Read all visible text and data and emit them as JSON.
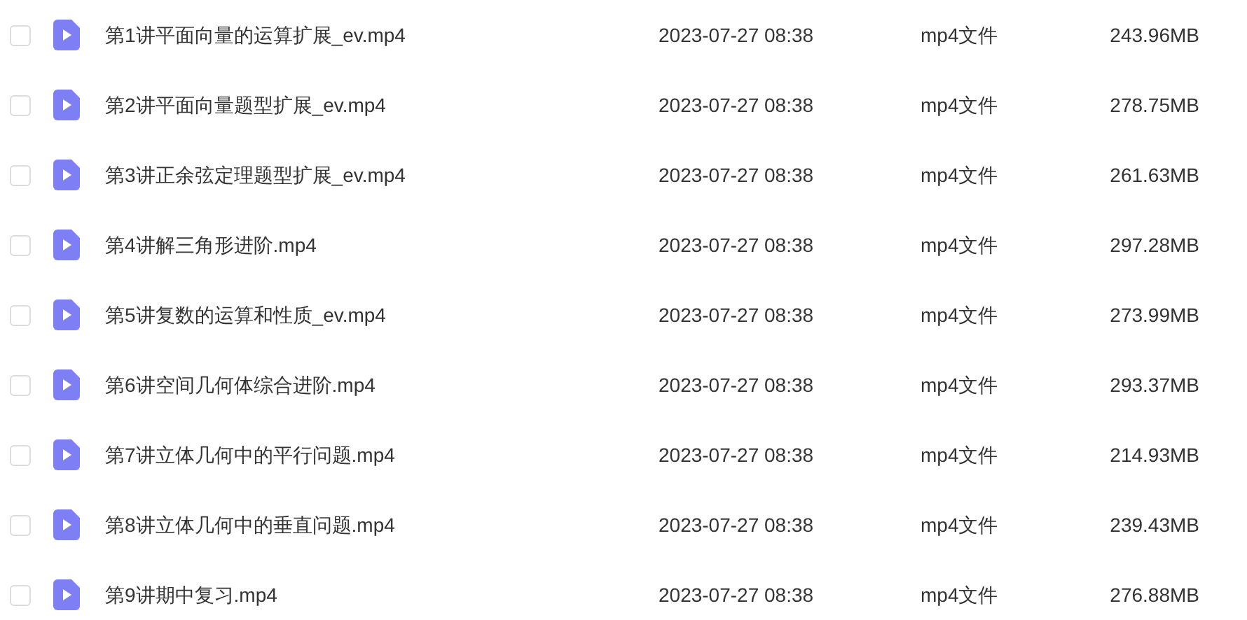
{
  "files": [
    {
      "name": "第1讲平面向量的运算扩展_ev.mp4",
      "date": "2023-07-27 08:38",
      "type": "mp4文件",
      "size": "243.96MB",
      "checked": false
    },
    {
      "name": "第2讲平面向量题型扩展_ev.mp4",
      "date": "2023-07-27 08:38",
      "type": "mp4文件",
      "size": "278.75MB",
      "checked": false
    },
    {
      "name": "第3讲正余弦定理题型扩展_ev.mp4",
      "date": "2023-07-27 08:38",
      "type": "mp4文件",
      "size": "261.63MB",
      "checked": false
    },
    {
      "name": "第4讲解三角形进阶.mp4",
      "date": "2023-07-27 08:38",
      "type": "mp4文件",
      "size": "297.28MB",
      "checked": false
    },
    {
      "name": "第5讲复数的运算和性质_ev.mp4",
      "date": "2023-07-27 08:38",
      "type": "mp4文件",
      "size": "273.99MB",
      "checked": false
    },
    {
      "name": "第6讲空间几何体综合进阶.mp4",
      "date": "2023-07-27 08:38",
      "type": "mp4文件",
      "size": "293.37MB",
      "checked": false
    },
    {
      "name": "第7讲立体几何中的平行问题.mp4",
      "date": "2023-07-27 08:38",
      "type": "mp4文件",
      "size": "214.93MB",
      "checked": false
    },
    {
      "name": "第8讲立体几何中的垂直问题.mp4",
      "date": "2023-07-27 08:38",
      "type": "mp4文件",
      "size": "239.43MB",
      "checked": false
    },
    {
      "name": "第9讲期中复习.mp4",
      "date": "2023-07-27 08:38",
      "type": "mp4文件",
      "size": "276.88MB",
      "checked": false
    }
  ]
}
